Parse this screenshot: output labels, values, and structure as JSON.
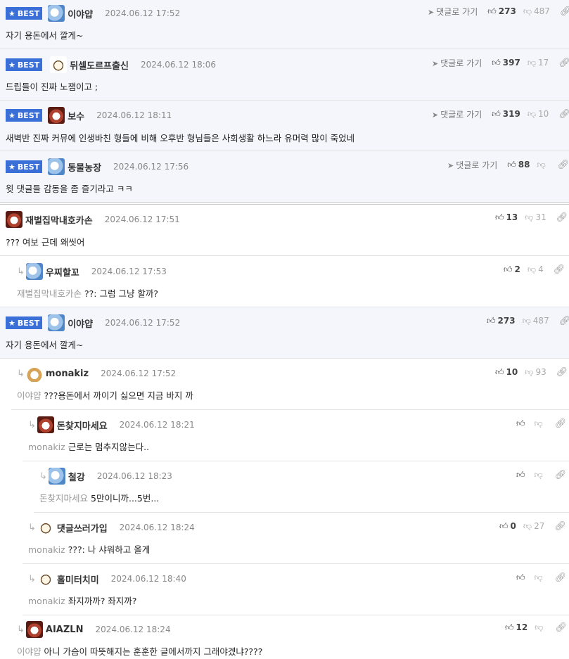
{
  "ui": {
    "best_badge": "BEST",
    "reply_link": "댓글로 가기"
  },
  "comments": [
    {
      "nick": "이야얍",
      "date": "2024.06.12 17:52",
      "text": "자기 용돈에서 깔게~",
      "up": "273",
      "down": "487"
    },
    {
      "nick": "뒤셀도르프출신",
      "date": "2024.06.12 18:06",
      "text": "드립들이 진짜 노잼이고 ;",
      "up": "397",
      "down": "17"
    },
    {
      "nick": "보수",
      "date": "2024.06.12 18:11",
      "text": "새벽반 진짜 커뮤에 인생바친 형들에 비해 오후반 형님들은 사회생활 하느라 유머력 많이 죽었네",
      "up": "319",
      "down": "10"
    },
    {
      "nick": "동물농장",
      "date": "2024.06.12 17:56",
      "text": "윗 댓글들 감동을 좀 즐기라고 ㅋㅋ",
      "up": "88",
      "down": ""
    },
    {
      "nick": "재벌집막내호카손",
      "date": "2024.06.12 17:51",
      "text": "??? 여보 근데 왜씻어",
      "up": "13",
      "down": "31"
    },
    {
      "nick": "우찌할꼬",
      "date": "2024.06.12 17:53",
      "mention": "재벌집막내호카손",
      "text": "??: 그럼 그냥 할까?",
      "up": "2",
      "down": "4"
    },
    {
      "nick": "이야얍",
      "date": "2024.06.12 17:52",
      "text": "자기 용돈에서 깔게~",
      "up": "273",
      "down": "487"
    },
    {
      "nick": "monakiz",
      "date": "2024.06.12 17:52",
      "mention": "이야얍",
      "text": "???용돈에서 까이기 싫으면 지금 바지 까",
      "up": "10",
      "down": "93"
    },
    {
      "nick": "돈찾지마세요",
      "date": "2024.06.12 18:21",
      "mention": "monakiz",
      "text": "근로는 멈추지않는다..",
      "up": "",
      "down": ""
    },
    {
      "nick": "철강",
      "date": "2024.06.12 18:23",
      "mention": "돈찾지마세요",
      "text": "5만이니까...5번...",
      "up": "",
      "down": ""
    },
    {
      "nick": "댓글쓰러가입",
      "date": "2024.06.12 18:24",
      "mention": "monakiz",
      "text": "???: 나 샤워하고 올게",
      "up": "0",
      "down": "27"
    },
    {
      "nick": "홀미터치미",
      "date": "2024.06.12 18:40",
      "mention": "monakiz",
      "text": "좌지까까? 좌지까?",
      "up": "",
      "down": ""
    },
    {
      "nick": "AIAZLN",
      "date": "2024.06.12 18:24",
      "mention": "이야얍",
      "text": "아니 가슴이 따뜻해지는 훈훈한 글에서까지 그래야겠냐????",
      "up": "12",
      "down": ""
    }
  ],
  "icons": {
    "star": "star-icon",
    "reply_arrow": "reply-arrow-icon",
    "thumbs_up": "thumbs-up-icon",
    "thumbs_down": "thumbs-down-icon",
    "link": "link-icon",
    "send": "send-icon"
  },
  "colors": {
    "best_badge": "#3a6fd8",
    "best_background": "#f5f6fb"
  }
}
